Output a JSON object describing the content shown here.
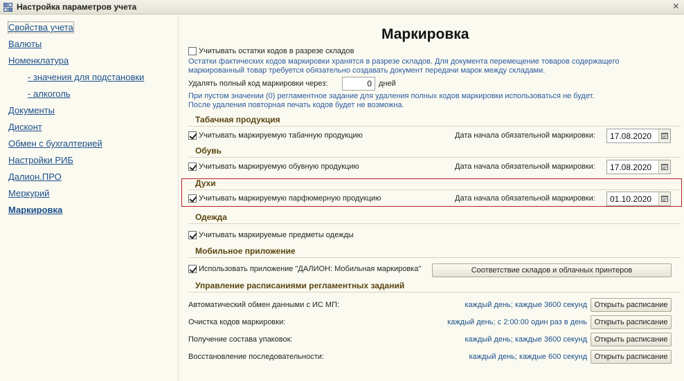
{
  "window": {
    "title": "Настройка параметров учета",
    "close_label": "×"
  },
  "sidebar": {
    "items": [
      {
        "label": "Свойства учета"
      },
      {
        "label": "Валюты"
      },
      {
        "label": "Номенклатура"
      },
      {
        "label": "- значения для подстановки"
      },
      {
        "label": "- алкоголь"
      },
      {
        "label": "Документы"
      },
      {
        "label": "Дисконт"
      },
      {
        "label": "Обмен с бухгалтерией"
      },
      {
        "label": "Настройки РИБ"
      },
      {
        "label": "Далион.ПРО"
      },
      {
        "label": "Меркурий"
      },
      {
        "label": "Маркировка"
      }
    ]
  },
  "main": {
    "heading": "Маркировка",
    "warehouse_stock": {
      "checkbox_label": "Учитывать остатки кодов в разрезе складов",
      "checked": false,
      "hint_line1": "Остатки фактических кодов маркировки хранятся в разрезе складов. Для документа перемещение товаров содержащего",
      "hint_line2": "маркированный товар требуется обязательно создавать документ передачи марок между складами."
    },
    "delete_codes": {
      "label": "Удалять полный код маркировки через:",
      "value": "0",
      "unit": "дней",
      "hint_line1": "При пустом значении (0) регламентное задание для удаления полных кодов маркировки использоваться не будет.",
      "hint_line2": "После удаления повторная печать кодов будет не возможна."
    },
    "date_label": "Дата начала обязательной маркировки:",
    "tobacco": {
      "section": "Табачная продукция",
      "checkbox_label": "Учитывать маркируемую табачную продукцию",
      "checked": true,
      "date": "17.08.2020"
    },
    "shoes": {
      "section": "Обувь",
      "checkbox_label": "Учитывать маркируемую обувную продукцию",
      "checked": true,
      "date": "17.08.2020"
    },
    "perfume": {
      "section": "Духи",
      "checkbox_label": "Учитывать маркируемую парфюмерную продукцию",
      "checked": true,
      "date": "01.10.2020"
    },
    "clothes": {
      "section": "Одежда",
      "checkbox_label": "Учитывать маркируемые предметы одежды",
      "checked": true
    },
    "mobile": {
      "section": "Мобильное приложение",
      "checkbox_label": "Использовать приложение \"ДАЛИОН: Мобильная маркировка\"",
      "checked": true,
      "button_label": "Соответствие складов и облачных принтеров"
    },
    "schedules": {
      "section": "Управление расписаниями регламентных заданий",
      "button_label": "Открыть расписание",
      "rows": [
        {
          "label": "Автоматический обмен данными с ИС МП:",
          "schedule": "каждый день; каждые 3600 секунд"
        },
        {
          "label": "Очистка кодов маркировки:",
          "schedule": "каждый день; с 2:00:00 один раз в день"
        },
        {
          "label": "Получение состава упаковок:",
          "schedule": "каждый день; каждые 3600 секунд"
        },
        {
          "label": "Восстановление последовательности:",
          "schedule": "каждый день; каждые 600 секунд"
        }
      ]
    }
  }
}
